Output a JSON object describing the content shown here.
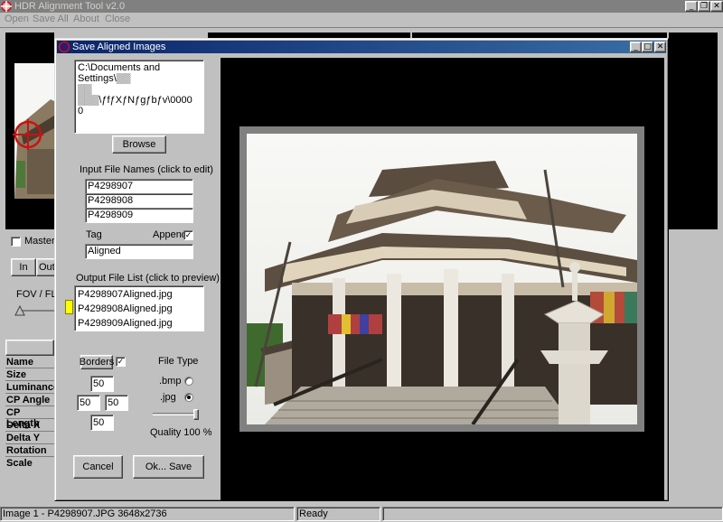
{
  "app": {
    "title": "HDR Alignment Tool  v2.0",
    "menu": [
      "Open",
      "Save All",
      "About",
      "Close"
    ]
  },
  "left_panel": {
    "master_label": "Master",
    "in_label": "In",
    "out_label": "Out",
    "fov_label": "FOV / FL",
    "properties": [
      "Name",
      "Size",
      "Luminance",
      "CP Angle",
      "CP Length",
      "Delta X",
      "Delta Y",
      "Rotation",
      "Scale"
    ]
  },
  "dialog": {
    "title": "Save Aligned Images",
    "path_text": "C:\\Documents and Settings\\▒▒\n▒▒ ▒▒▒\\ƒfƒXƒNƒgƒbƒv\\0000\n0",
    "browse_label": "Browse",
    "input_names_label": "Input File Names  (click to edit)",
    "input_names": [
      "P4298907",
      "P4298908",
      "P4298909"
    ],
    "tag_label": "Tag",
    "append_label": "Append",
    "tag_value": "Aligned",
    "output_list_label": "Output File List  (click to preview)",
    "output_files": [
      "P4298907Aligned.jpg",
      "P4298908Aligned.jpg",
      "P4298909Aligned.jpg"
    ],
    "selected_output_index": 1,
    "borders_label": "Borders",
    "borders": {
      "top": "50",
      "left": "50",
      "right": "50",
      "bottom": "50"
    },
    "file_type_label": "File Type",
    "bmp_label": ".bmp",
    "jpg_label": ".jpg",
    "selected_type": "jpg",
    "quality_label": "Quality 100 %",
    "quality_value": 100,
    "cancel_label": "Cancel",
    "ok_label": "Ok... Save"
  },
  "status": {
    "image_info": "Image 1 - P4298907.JPG   3648x2736",
    "state": "Ready"
  },
  "colors": {
    "face": "#c0c0c0",
    "dialog_title": "#0a246a",
    "highlight": "#ffff00",
    "marker": "#cc1111"
  },
  "icons": {
    "app": "crosshair-icon",
    "minimize": "minimize-icon",
    "maximize": "maximize-icon",
    "close": "close-icon"
  }
}
